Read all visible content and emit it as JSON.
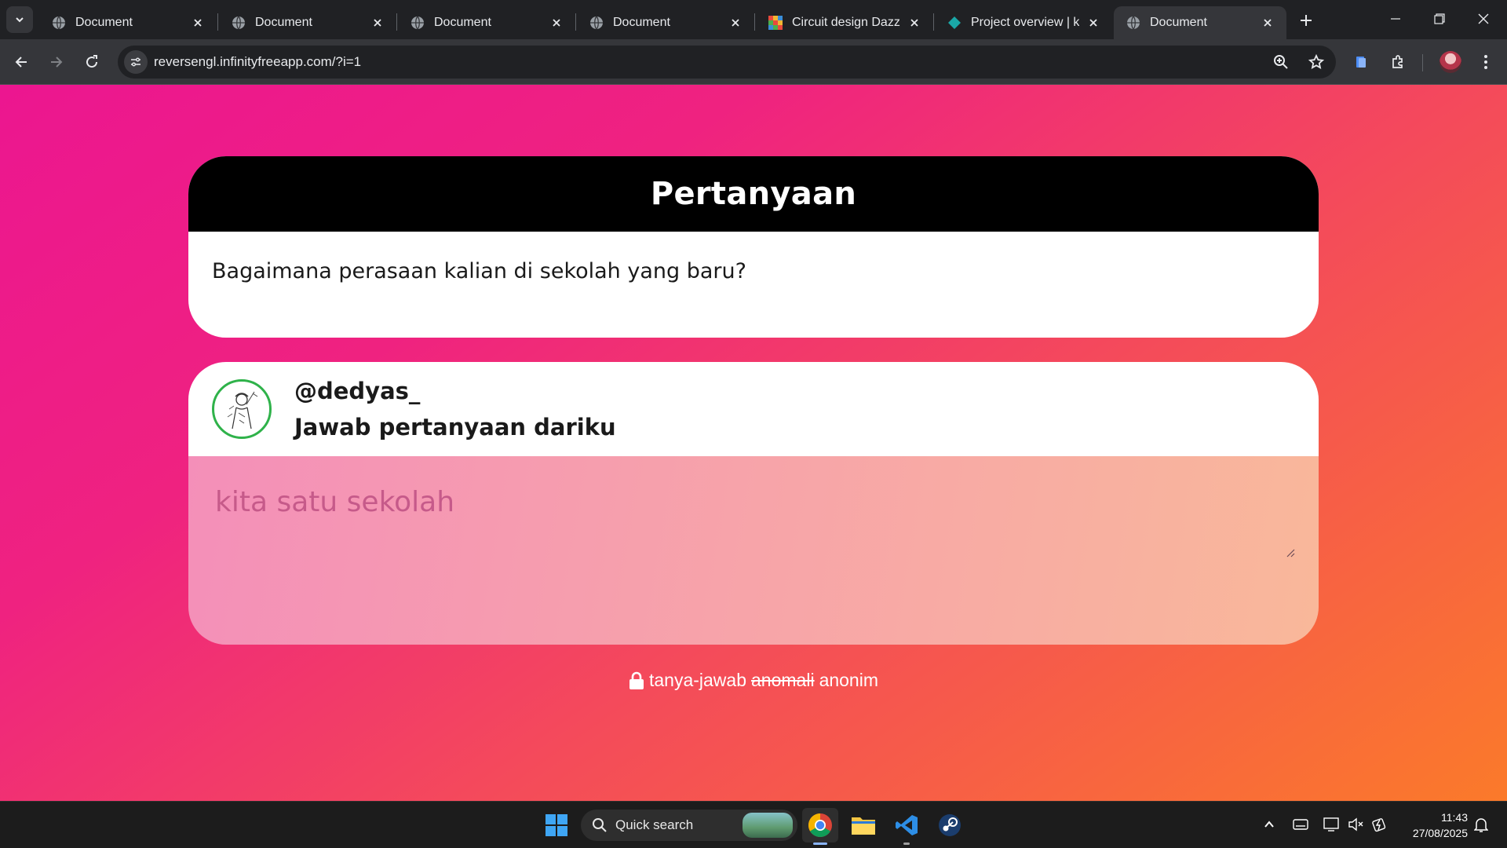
{
  "browser": {
    "tabs": [
      {
        "title": "Document",
        "favicon": "globe-icon",
        "active": false
      },
      {
        "title": "Document",
        "favicon": "globe-icon",
        "active": false
      },
      {
        "title": "Document",
        "favicon": "globe-icon",
        "active": false
      },
      {
        "title": "Document",
        "favicon": "globe-icon",
        "active": false
      },
      {
        "title": "Circuit design Dazzlin",
        "favicon": "tinkercad-icon",
        "active": false
      },
      {
        "title": "Project overview | kn",
        "favicon": "diamond-icon",
        "active": false
      },
      {
        "title": "Document",
        "favicon": "globe-icon",
        "active": true
      }
    ],
    "url": "reversengl.infinityfreeapp.com/?i=1"
  },
  "page": {
    "question_header": "Pertanyaan",
    "question_text": "Bagaimana perasaan kalian di sekolah yang baru?",
    "username": "@dedyas_",
    "answer_prompt": "Jawab pertanyaan dariku",
    "answer_placeholder": "kita satu sekolah",
    "footer": {
      "part1": "tanya-jawab",
      "struck": "anomali",
      "part2": "anonim"
    }
  },
  "taskbar": {
    "search_label": "Quick search",
    "time": "11:43",
    "date": "27/08/2025"
  },
  "colors": {
    "gradient_start": "#ec1690",
    "gradient_end": "#fb7a2a",
    "avatar_ring": "#2fb24a"
  }
}
